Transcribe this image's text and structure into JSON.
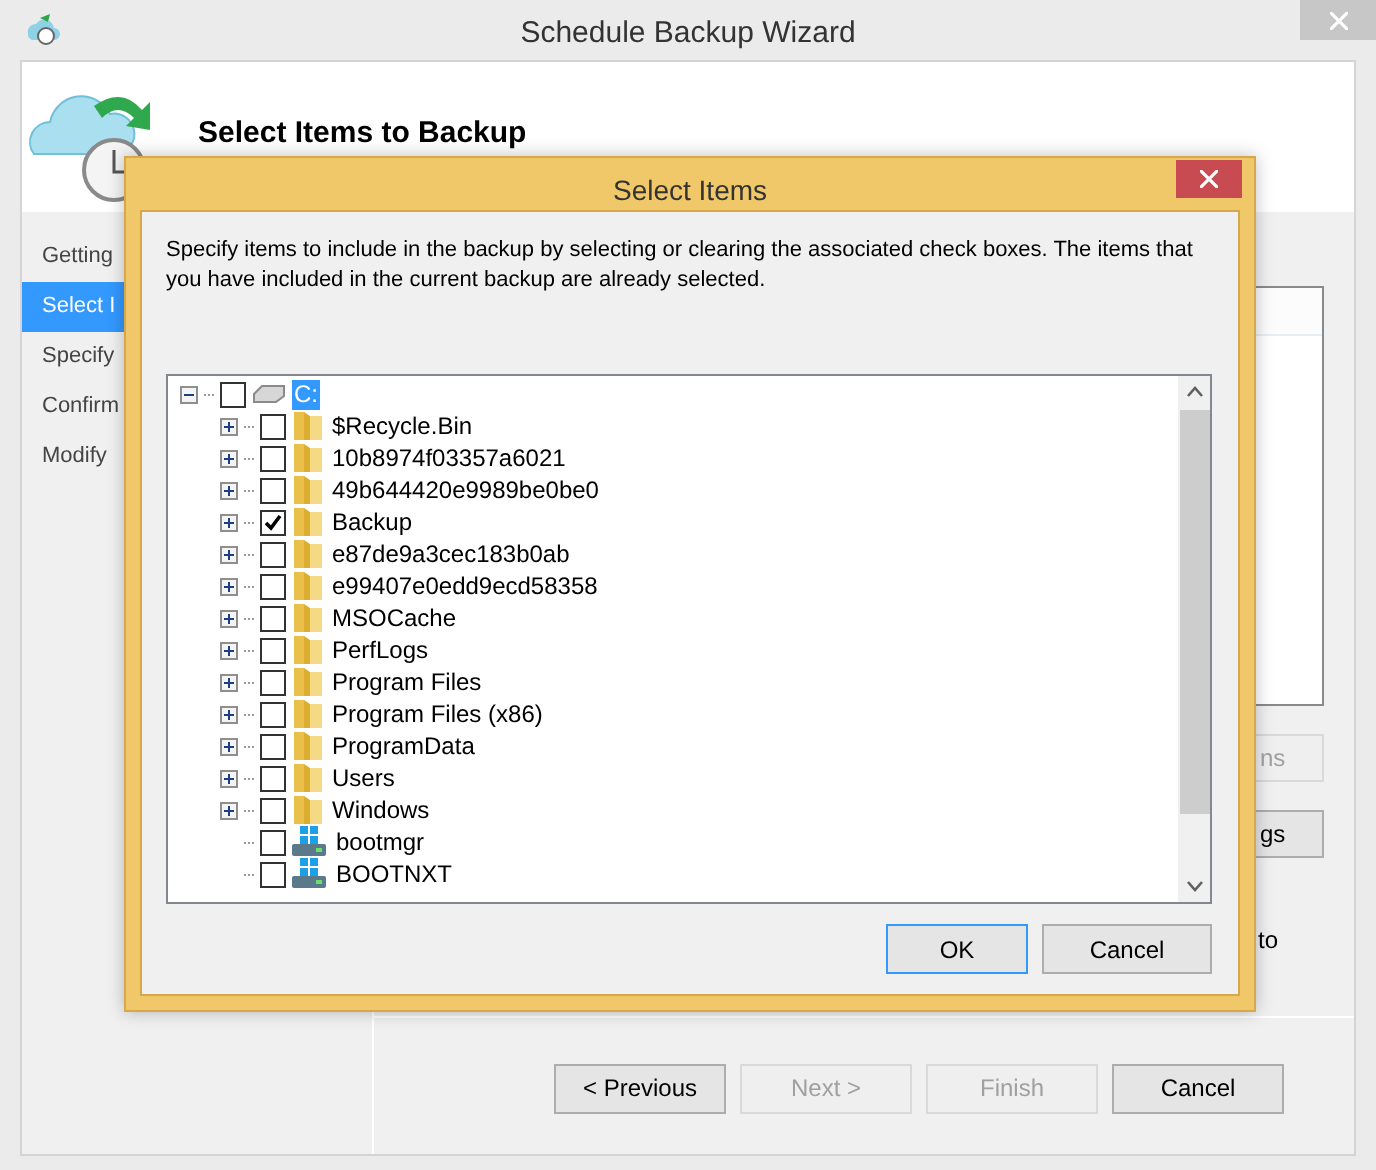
{
  "window": {
    "title": "Schedule Backup Wizard"
  },
  "header": {
    "title": "Select Items to Backup"
  },
  "steps": [
    {
      "label": "Getting",
      "selected": false
    },
    {
      "label": "Select I",
      "selected": true
    },
    {
      "label": "Specify",
      "selected": false
    },
    {
      "label": "Confirm",
      "selected": false
    },
    {
      "label": "Modify",
      "selected": false
    }
  ],
  "side_buttons": [
    {
      "label": "ns",
      "disabled": true
    },
    {
      "label": "gs",
      "disabled": false
    }
  ],
  "side_text": "to",
  "nav_buttons": [
    {
      "label": "< Previous",
      "disabled": false
    },
    {
      "label": "Next >",
      "disabled": true
    },
    {
      "label": "Finish",
      "disabled": true
    },
    {
      "label": "Cancel",
      "disabled": false
    }
  ],
  "dialog": {
    "title": "Select Items",
    "description": "Specify items to include in the backup by selecting or clearing the associated check boxes. The items that you have included in the current backup are already selected.",
    "tree": {
      "label": "C:",
      "kind": "drive",
      "checked": false,
      "expanded": true,
      "selected": true,
      "children": [
        {
          "label": "$Recycle.Bin",
          "kind": "folder",
          "checked": false,
          "expanded": false,
          "selected": false
        },
        {
          "label": "10b8974f03357a6021",
          "kind": "folder",
          "checked": false,
          "expanded": false,
          "selected": false
        },
        {
          "label": "49b644420e9989be0be0",
          "kind": "folder",
          "checked": false,
          "expanded": false,
          "selected": false
        },
        {
          "label": "Backup",
          "kind": "folder",
          "checked": true,
          "expanded": false,
          "selected": false
        },
        {
          "label": "e87de9a3cec183b0ab",
          "kind": "folder",
          "checked": false,
          "expanded": false,
          "selected": false
        },
        {
          "label": "e99407e0edd9ecd58358",
          "kind": "folder",
          "checked": false,
          "expanded": false,
          "selected": false
        },
        {
          "label": "MSOCache",
          "kind": "folder",
          "checked": false,
          "expanded": false,
          "selected": false
        },
        {
          "label": "PerfLogs",
          "kind": "folder",
          "checked": false,
          "expanded": false,
          "selected": false
        },
        {
          "label": "Program Files",
          "kind": "folder",
          "checked": false,
          "expanded": false,
          "selected": false
        },
        {
          "label": "Program Files (x86)",
          "kind": "folder",
          "checked": false,
          "expanded": false,
          "selected": false
        },
        {
          "label": "ProgramData",
          "kind": "folder",
          "checked": false,
          "expanded": false,
          "selected": false
        },
        {
          "label": "Users",
          "kind": "folder",
          "checked": false,
          "expanded": false,
          "selected": false
        },
        {
          "label": "Windows",
          "kind": "folder",
          "checked": false,
          "expanded": false,
          "selected": false
        },
        {
          "label": "bootmgr",
          "kind": "file",
          "checked": false,
          "selected": false
        },
        {
          "label": "BOOTNXT",
          "kind": "file",
          "checked": false,
          "selected": false
        }
      ]
    },
    "buttons": [
      {
        "label": "OK",
        "default": true
      },
      {
        "label": "Cancel",
        "default": false
      }
    ]
  }
}
